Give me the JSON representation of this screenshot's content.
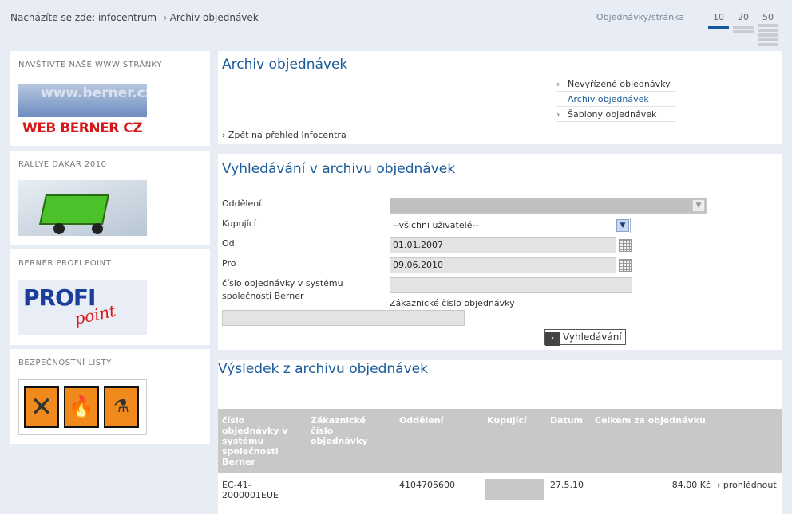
{
  "breadcrumb": {
    "prefix": "Nacházíte se zde:",
    "items": [
      "infocentrum",
      "Archiv objednávek"
    ]
  },
  "per_page": {
    "label": "Objednávky/stránka",
    "options": [
      "10",
      "20",
      "50"
    ],
    "selected": "10"
  },
  "sidebar": [
    {
      "title": "NAVŠTIVTE NAŠE WWW STRÁNKY",
      "banner_text": "WEB BERNER CZ",
      "banner_sub": "www.berner.cz"
    },
    {
      "title": "RALLYE DAKAR 2010"
    },
    {
      "title": "BERNER PROFI POINT",
      "banner_text": "PROFI",
      "banner_sub": "point"
    },
    {
      "title": "BEZPEČNOSTNÍ LISTY"
    }
  ],
  "archive": {
    "title": "Archiv objednávek",
    "links": [
      "Nevyřízené objednávky",
      "Archiv objednávek",
      "Šablony objednávek"
    ],
    "back_link": "Zpět na přehled Infocentra"
  },
  "search": {
    "title": "Vyhledávání v archivu objednávek",
    "department_label": "Oddělení",
    "department_value": "",
    "buyer_label": "Kupující",
    "buyer_value": "--všichni uživatelé--",
    "from_label": "Od",
    "from_value": "01.01.2007",
    "to_label": "Pro",
    "to_value": "09.06.2010",
    "order_no_label": "číslo objednávky v systému společnosti Berner",
    "order_no_value": "",
    "customer_no_label": "Zákaznické číslo objednávky",
    "customer_no_value": "",
    "button": "Vyhledávání"
  },
  "results": {
    "title": "Výsledek z archivu objednávek",
    "columns": [
      "číslo objednávky v systému společnosti Berner",
      "Zákaznické číslo objednávky",
      "Oddělení",
      "Kupující",
      "Datum",
      "Celkem za objednávku"
    ],
    "rows": [
      {
        "order_no": "EC-41-2000001EUE",
        "customer_no": "",
        "department": "4104705600",
        "buyer": "",
        "date": "27.5.10",
        "total": "84,00 Kč",
        "action": "prohlédnout"
      }
    ]
  }
}
